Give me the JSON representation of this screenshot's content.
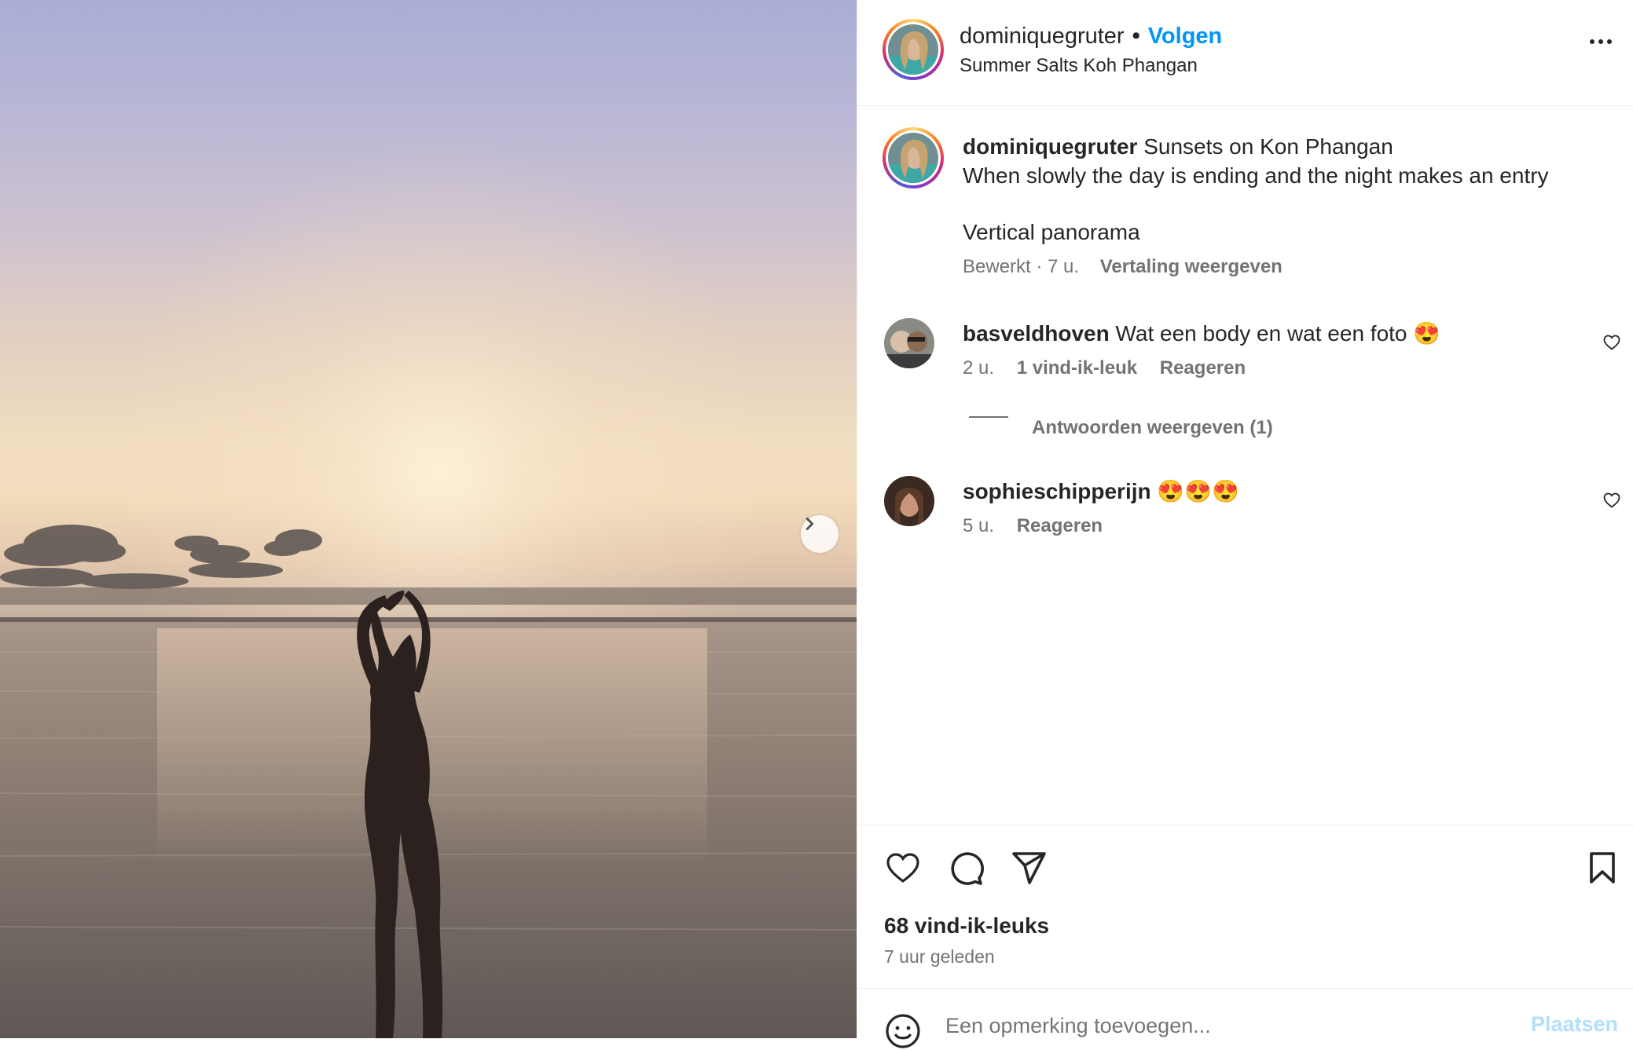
{
  "post_author": {
    "username": "dominiquegruter",
    "follow_label": "Volgen",
    "location": "Summer Salts Koh Phangan"
  },
  "caption": {
    "username": "dominiquegruter",
    "line1": "Sunsets on Kon Phangan",
    "line2": "When slowly the day is ending and the night makes an entry",
    "line3": "Vertical panorama",
    "meta": "Bewerkt · 7 u.",
    "translate_label": "Vertaling weergeven"
  },
  "comments": [
    {
      "username": "basveldhoven",
      "text": "Wat een body en wat een foto 😍",
      "time": "2 u.",
      "likes": "1 vind-ik-leuk",
      "reply_label": "Reageren",
      "view_replies": "Antwoorden weergeven (1)"
    },
    {
      "username": "sophieschipperijn",
      "text": "😍😍😍",
      "time": "5 u.",
      "reply_label": "Reageren"
    }
  ],
  "stats": {
    "likes": "68 vind-ik-leuks",
    "posted": "7 uur geleden"
  },
  "comment_input": {
    "placeholder": "Een opmerking toevoegen...",
    "post_label": "Plaatsen"
  },
  "icons": {
    "next": "chevron-right-icon",
    "like": "heart-icon",
    "comment": "comment-bubble-icon",
    "share": "paper-plane-icon",
    "save": "bookmark-icon",
    "emoji": "smiley-icon",
    "more": "more-options-icon"
  },
  "colors": {
    "accent": "#0095f6",
    "text": "#262626",
    "muted": "#737373"
  }
}
